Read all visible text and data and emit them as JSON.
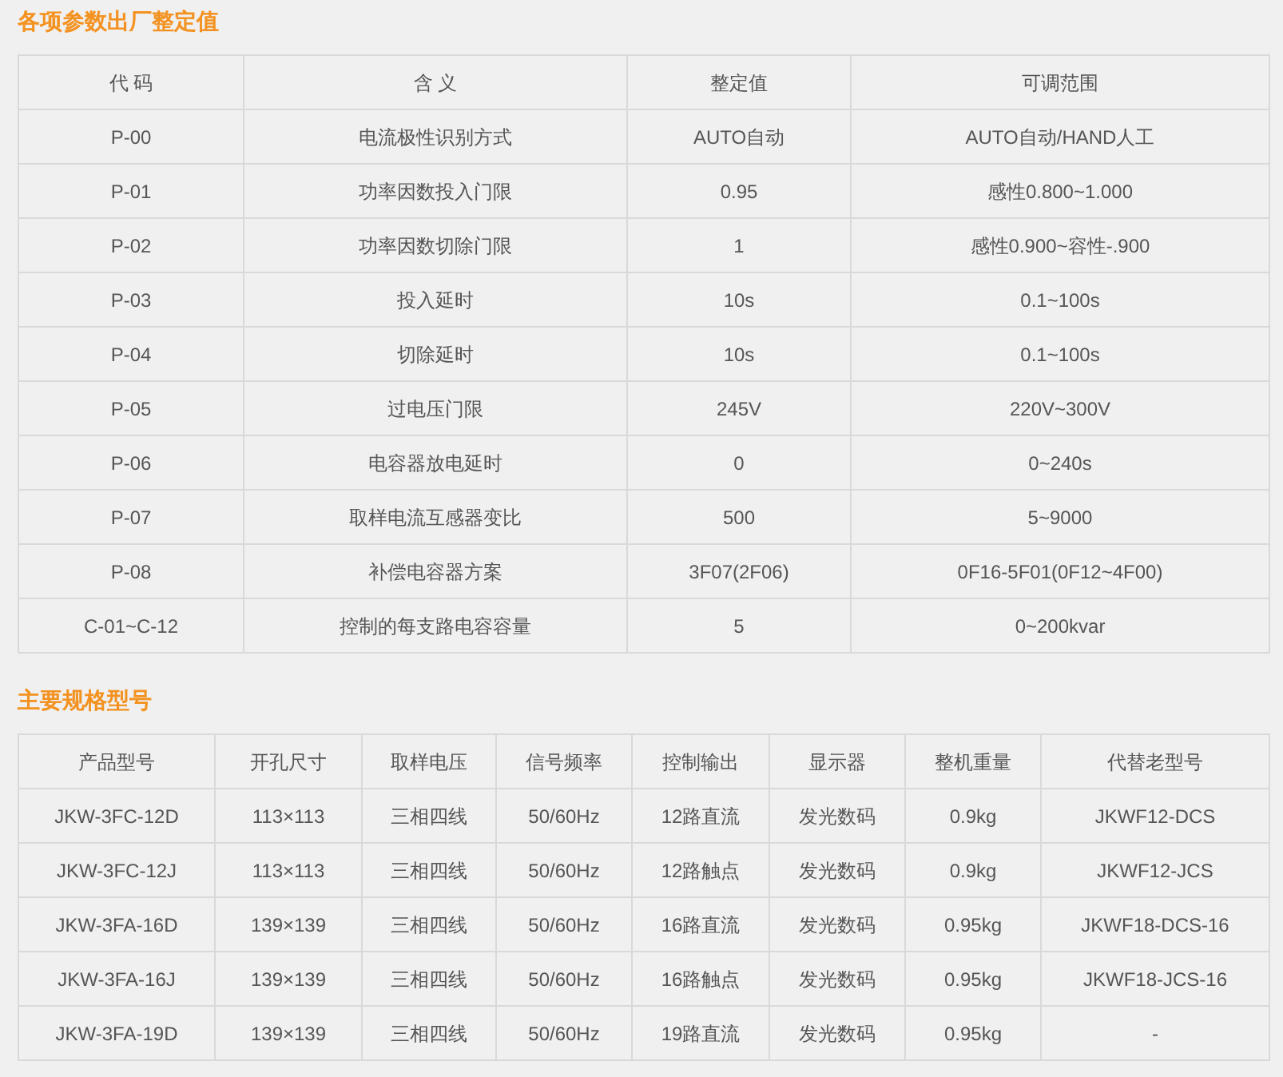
{
  "sections": [
    {
      "title": "各项参数出厂整定值",
      "table": {
        "columns": [
          "代 码",
          "含 义",
          "整定值",
          "可调范围"
        ],
        "rows": [
          [
            "P-00",
            "电流极性识别方式",
            "AUTO自动",
            "AUTO自动/HAND人工"
          ],
          [
            "P-01",
            "功率因数投入门限",
            "0.95",
            "感性0.800~1.000"
          ],
          [
            "P-02",
            "功率因数切除门限",
            "1",
            "感性0.900~容性-.900"
          ],
          [
            "P-03",
            "投入延时",
            "10s",
            "0.1~100s"
          ],
          [
            "P-04",
            "切除延时",
            "10s",
            "0.1~100s"
          ],
          [
            "P-05",
            "过电压门限",
            "245V",
            "220V~300V"
          ],
          [
            "P-06",
            "电容器放电延时",
            "0",
            "0~240s"
          ],
          [
            "P-07",
            "取样电流互感器变比",
            "500",
            "5~9000"
          ],
          [
            "P-08",
            "补偿电容器方案",
            "3F07(2F06)",
            "0F16-5F01(0F12~4F00)"
          ],
          [
            "C-01~C-12",
            "控制的每支路电容容量",
            "5",
            "0~200kvar"
          ]
        ]
      }
    },
    {
      "title": "主要规格型号",
      "table": {
        "columns": [
          "产品型号",
          "开孔尺寸",
          "取样电压",
          "信号频率",
          "控制输出",
          "显示器",
          "整机重量",
          "代替老型号"
        ],
        "rows": [
          [
            "JKW-3FC-12D",
            "113×113",
            "三相四线",
            "50/60Hz",
            "12路直流",
            "发光数码",
            "0.9kg",
            "JKWF12-DCS"
          ],
          [
            "JKW-3FC-12J",
            "113×113",
            "三相四线",
            "50/60Hz",
            "12路触点",
            "发光数码",
            "0.9kg",
            "JKWF12-JCS"
          ],
          [
            "JKW-3FA-16D",
            "139×139",
            "三相四线",
            "50/60Hz",
            "16路直流",
            "发光数码",
            "0.95kg",
            "JKWF18-DCS-16"
          ],
          [
            "JKW-3FA-16J",
            "139×139",
            "三相四线",
            "50/60Hz",
            "16路触点",
            "发光数码",
            "0.95kg",
            "JKWF18-JCS-16"
          ],
          [
            "JKW-3FA-19D",
            "139×139",
            "三相四线",
            "50/60Hz",
            "19路直流",
            "发光数码",
            "0.95kg",
            "-"
          ]
        ]
      }
    }
  ]
}
